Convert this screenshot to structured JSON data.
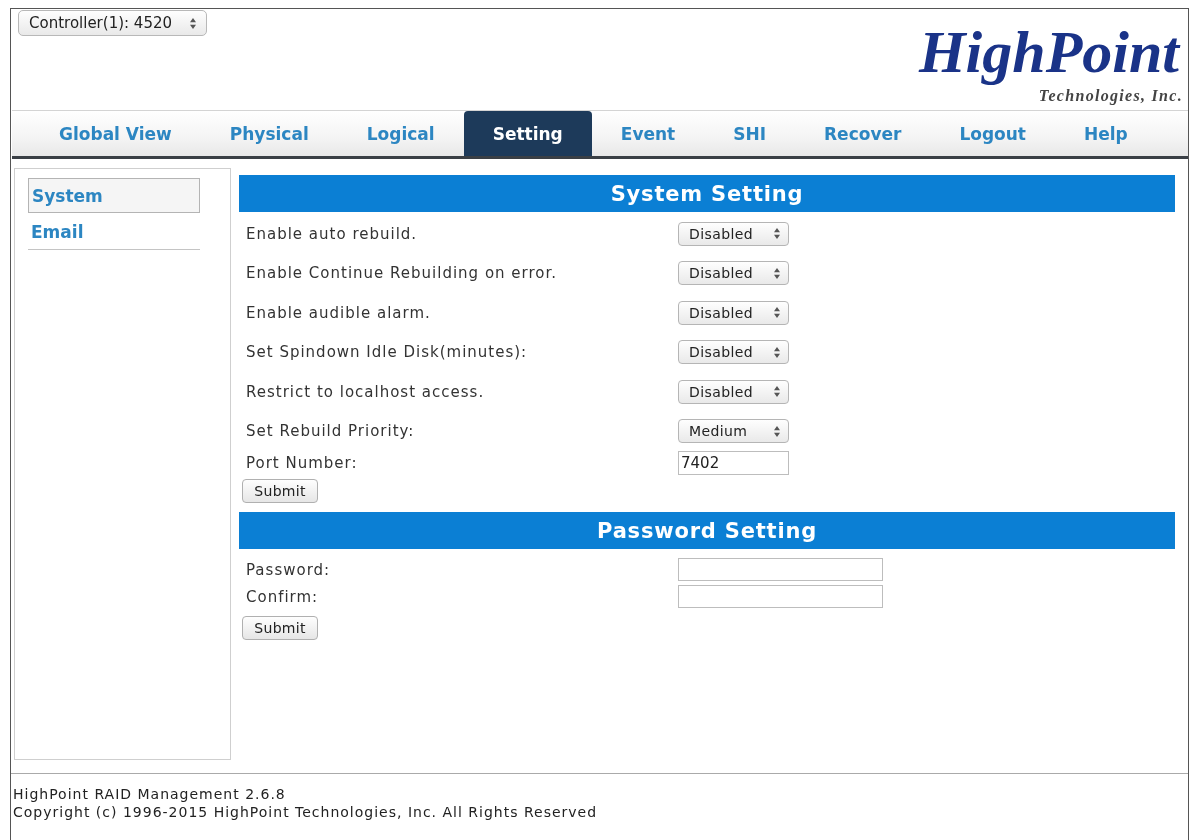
{
  "controller_select": {
    "value": "Controller(1): 4520"
  },
  "logo": {
    "name": "HighPoint",
    "tagline": "Technologies, Inc."
  },
  "tabs": [
    {
      "label": "Global View",
      "selected": false
    },
    {
      "label": "Physical",
      "selected": false
    },
    {
      "label": "Logical",
      "selected": false
    },
    {
      "label": "Setting",
      "selected": true
    },
    {
      "label": "Event",
      "selected": false
    },
    {
      "label": "SHI",
      "selected": false
    },
    {
      "label": "Recover",
      "selected": false
    },
    {
      "label": "Logout",
      "selected": false
    },
    {
      "label": "Help",
      "selected": false
    }
  ],
  "sidebar": {
    "items": [
      {
        "label": "System",
        "selected": true
      },
      {
        "label": "Email",
        "selected": false
      }
    ]
  },
  "sections": [
    {
      "title": "System Setting",
      "fields": [
        {
          "kind": "select",
          "label": "Enable auto rebuild.",
          "value": "Disabled"
        },
        {
          "kind": "select",
          "label": "Enable Continue Rebuilding on error.",
          "value": "Disabled"
        },
        {
          "kind": "select",
          "label": "Enable audible alarm.",
          "value": "Disabled"
        },
        {
          "kind": "select",
          "label": "Set Spindown Idle Disk(minutes):",
          "value": "Disabled"
        },
        {
          "kind": "select",
          "label": "Restrict to localhost access.",
          "value": "Disabled"
        },
        {
          "kind": "select",
          "label": "Set Rebuild Priority:",
          "value": "Medium"
        },
        {
          "kind": "text",
          "label": "Port Number:",
          "value": "7402"
        }
      ],
      "submit": "Submit"
    },
    {
      "title": "Password Setting",
      "fields": [
        {
          "kind": "password",
          "label": "Password:"
        },
        {
          "kind": "password",
          "label": "Confirm:"
        }
      ],
      "submit": "Submit"
    }
  ],
  "footer": {
    "lines": [
      "HighPoint RAID Management 2.6.8",
      "Copyright (c) 1996-2015 HighPoint Technologies, Inc. All Rights Reserved"
    ]
  }
}
